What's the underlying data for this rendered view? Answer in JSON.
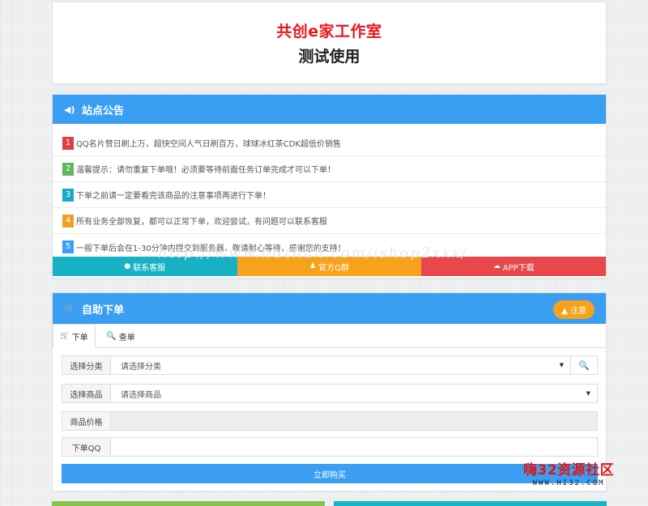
{
  "header": {
    "title": "共创e家工作室",
    "subtitle": "测试使用"
  },
  "notice": {
    "title": "站点公告",
    "items": [
      {
        "num": "1",
        "text": "QQ名片赞日刷上万，超快空间人气日刷百万，球球冰红茶CDK超低价销售"
      },
      {
        "num": "2",
        "text": "温馨提示：请勿重复下单哦！必须要等待前面任务订单完成才可以下单！"
      },
      {
        "num": "3",
        "text": "下单之前请一定要看完该商品的注意事项再进行下单！"
      },
      {
        "num": "4",
        "text": "所有业务全部恢复，都可以正常下单，欢迎尝试，有问题可以联系客服"
      },
      {
        "num": "5",
        "text": "一般下单后会在1-30分钟内提交到服务器，敬请耐心等待，感谢您的支持！"
      }
    ],
    "buttons": {
      "contact": "联系客服",
      "qq_group": "官方Q群",
      "app": "APP下载"
    },
    "colors": {
      "bar": "#3a9ff2",
      "contact": "#16b2c4",
      "qq_group": "#f7a21b",
      "app": "#e8474c"
    }
  },
  "watermark": "http://www.huzhan.com/ishop2xxx/",
  "order": {
    "title": "自助下单",
    "notice_button": "注意",
    "tabs": [
      {
        "label": "下单",
        "icon": "cart-icon"
      },
      {
        "label": "查单",
        "icon": "search-icon"
      }
    ],
    "fields": {
      "category_label": "选择分类",
      "category_value": "请选择分类",
      "product_label": "选择商品",
      "product_value": "请选择商品",
      "price_label": "商品价格",
      "price_value": "",
      "qq_label": "下单QQ",
      "qq_value": ""
    },
    "buy_button": "立即购买"
  },
  "stamp": {
    "name": "嗨32资源社区",
    "url": "WWW.HI32.COM"
  }
}
